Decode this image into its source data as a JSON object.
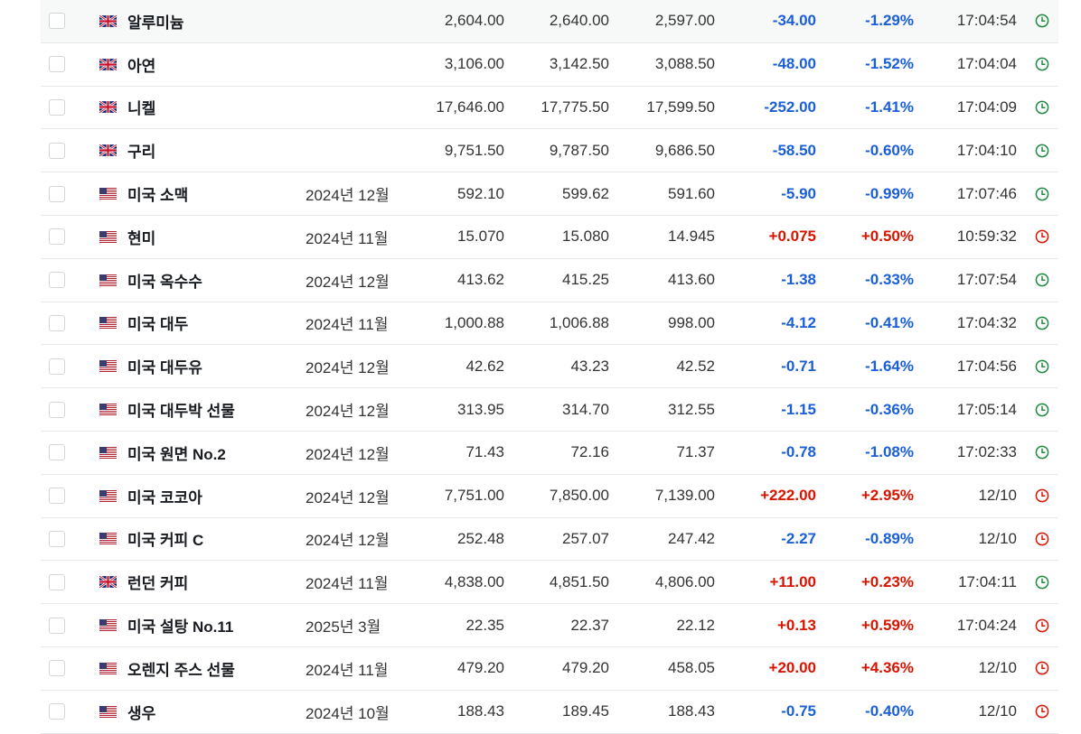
{
  "colors": {
    "negative": "#1a5fd8",
    "positive": "#d91400",
    "clock_open": "#1e8a3c",
    "clock_closed": "#d91400"
  },
  "rows": [
    {
      "flag": "uk-flag-icon",
      "name": "알루미늄",
      "month": "",
      "last": "2,604.00",
      "high": "2,640.00",
      "low": "2,597.00",
      "change": "-34.00",
      "pct": "-1.29%",
      "time": "17:04:54",
      "clock": "green"
    },
    {
      "flag": "uk-flag-icon",
      "name": "아연",
      "month": "",
      "last": "3,106.00",
      "high": "3,142.50",
      "low": "3,088.50",
      "change": "-48.00",
      "pct": "-1.52%",
      "time": "17:04:04",
      "clock": "green"
    },
    {
      "flag": "uk-flag-icon",
      "name": "니켈",
      "month": "",
      "last": "17,646.00",
      "high": "17,775.50",
      "low": "17,599.50",
      "change": "-252.00",
      "pct": "-1.41%",
      "time": "17:04:09",
      "clock": "green"
    },
    {
      "flag": "uk-flag-icon",
      "name": "구리",
      "month": "",
      "last": "9,751.50",
      "high": "9,787.50",
      "low": "9,686.50",
      "change": "-58.50",
      "pct": "-0.60%",
      "time": "17:04:10",
      "clock": "green"
    },
    {
      "flag": "us-flag-icon",
      "name": "미국 소맥",
      "month": "2024년 12월",
      "last": "592.10",
      "high": "599.62",
      "low": "591.60",
      "change": "-5.90",
      "pct": "-0.99%",
      "time": "17:07:46",
      "clock": "green"
    },
    {
      "flag": "us-flag-icon",
      "name": "현미",
      "month": "2024년 11월",
      "last": "15.070",
      "high": "15.080",
      "low": "14.945",
      "change": "+0.075",
      "pct": "+0.50%",
      "time": "10:59:32",
      "clock": "red"
    },
    {
      "flag": "us-flag-icon",
      "name": "미국 옥수수",
      "month": "2024년 12월",
      "last": "413.62",
      "high": "415.25",
      "low": "413.60",
      "change": "-1.38",
      "pct": "-0.33%",
      "time": "17:07:54",
      "clock": "green"
    },
    {
      "flag": "us-flag-icon",
      "name": "미국 대두",
      "month": "2024년 11월",
      "last": "1,000.88",
      "high": "1,006.88",
      "low": "998.00",
      "change": "-4.12",
      "pct": "-0.41%",
      "time": "17:04:32",
      "clock": "green"
    },
    {
      "flag": "us-flag-icon",
      "name": "미국 대두유",
      "month": "2024년 12월",
      "last": "42.62",
      "high": "43.23",
      "low": "42.52",
      "change": "-0.71",
      "pct": "-1.64%",
      "time": "17:04:56",
      "clock": "green"
    },
    {
      "flag": "us-flag-icon",
      "name": "미국 대두박 선물",
      "month": "2024년 12월",
      "last": "313.95",
      "high": "314.70",
      "low": "312.55",
      "change": "-1.15",
      "pct": "-0.36%",
      "time": "17:05:14",
      "clock": "green"
    },
    {
      "flag": "us-flag-icon",
      "name": "미국 원면 No.2",
      "month": "2024년 12월",
      "last": "71.43",
      "high": "72.16",
      "low": "71.37",
      "change": "-0.78",
      "pct": "-1.08%",
      "time": "17:02:33",
      "clock": "green"
    },
    {
      "flag": "us-flag-icon",
      "name": "미국 코코아",
      "month": "2024년 12월",
      "last": "7,751.00",
      "high": "7,850.00",
      "low": "7,139.00",
      "change": "+222.00",
      "pct": "+2.95%",
      "time": "12/10",
      "clock": "red"
    },
    {
      "flag": "us-flag-icon",
      "name": "미국 커피 C",
      "month": "2024년 12월",
      "last": "252.48",
      "high": "257.07",
      "low": "247.42",
      "change": "-2.27",
      "pct": "-0.89%",
      "time": "12/10",
      "clock": "red"
    },
    {
      "flag": "uk-flag-icon",
      "name": "런던 커피",
      "month": "2024년 11월",
      "last": "4,838.00",
      "high": "4,851.50",
      "low": "4,806.00",
      "change": "+11.00",
      "pct": "+0.23%",
      "time": "17:04:11",
      "clock": "green"
    },
    {
      "flag": "us-flag-icon",
      "name": "미국 설탕 No.11",
      "month": "2025년 3월",
      "last": "22.35",
      "high": "22.37",
      "low": "22.12",
      "change": "+0.13",
      "pct": "+0.59%",
      "time": "17:04:24",
      "clock": "red"
    },
    {
      "flag": "us-flag-icon",
      "name": "오렌지 주스 선물",
      "month": "2024년 11월",
      "last": "479.20",
      "high": "479.20",
      "low": "458.05",
      "change": "+20.00",
      "pct": "+4.36%",
      "time": "12/10",
      "clock": "red"
    },
    {
      "flag": "us-flag-icon",
      "name": "생우",
      "month": "2024년 10월",
      "last": "188.43",
      "high": "189.45",
      "low": "188.43",
      "change": "-0.75",
      "pct": "-0.40%",
      "time": "12/10",
      "clock": "red"
    }
  ]
}
